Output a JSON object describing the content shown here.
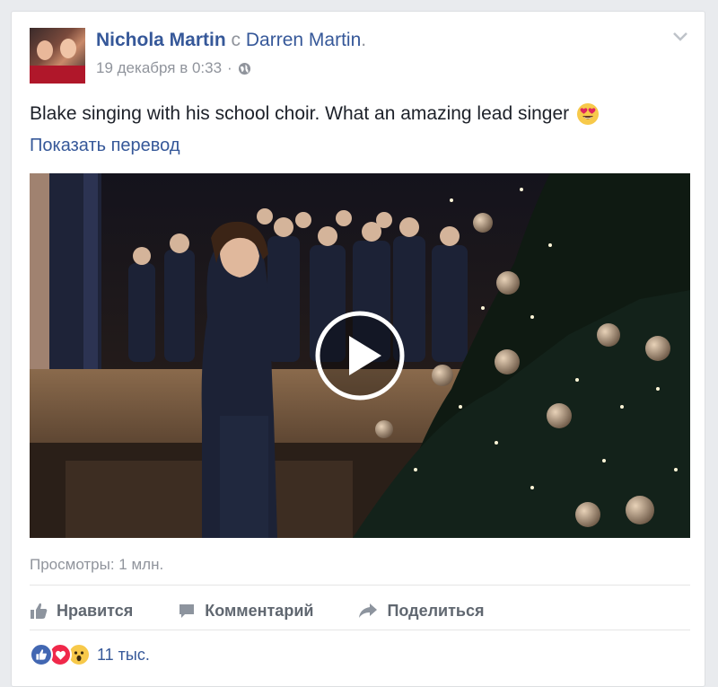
{
  "post": {
    "author": "Nichola Martin",
    "with_word": "с",
    "tagged": "Darren Martin",
    "tagged_suffix": ".",
    "timestamp": "19 декабря в 0:33",
    "meta_separator": "·",
    "privacy_icon": "globe-icon",
    "text": "Blake singing with his school choir. What an amazing lead singer",
    "text_emoji": "heart-eyes-emoji",
    "translate_label": "Показать перевод",
    "menu_icon": "chevron-down-icon"
  },
  "video": {
    "views": "Просмотры: 1 млн.",
    "play_icon": "play-icon"
  },
  "actions": {
    "like": "Нравится",
    "comment": "Комментарий",
    "share": "Поделиться"
  },
  "reactions": {
    "icons": [
      "like-reaction-icon",
      "love-reaction-icon",
      "wow-reaction-icon"
    ],
    "count": "11 тыс."
  },
  "colors": {
    "link": "#365899",
    "muted": "#90949c",
    "action_text": "#606770",
    "like_blue": "#4267b2",
    "love_red": "#f0284a",
    "wow_yellow": "#f7c94a"
  }
}
